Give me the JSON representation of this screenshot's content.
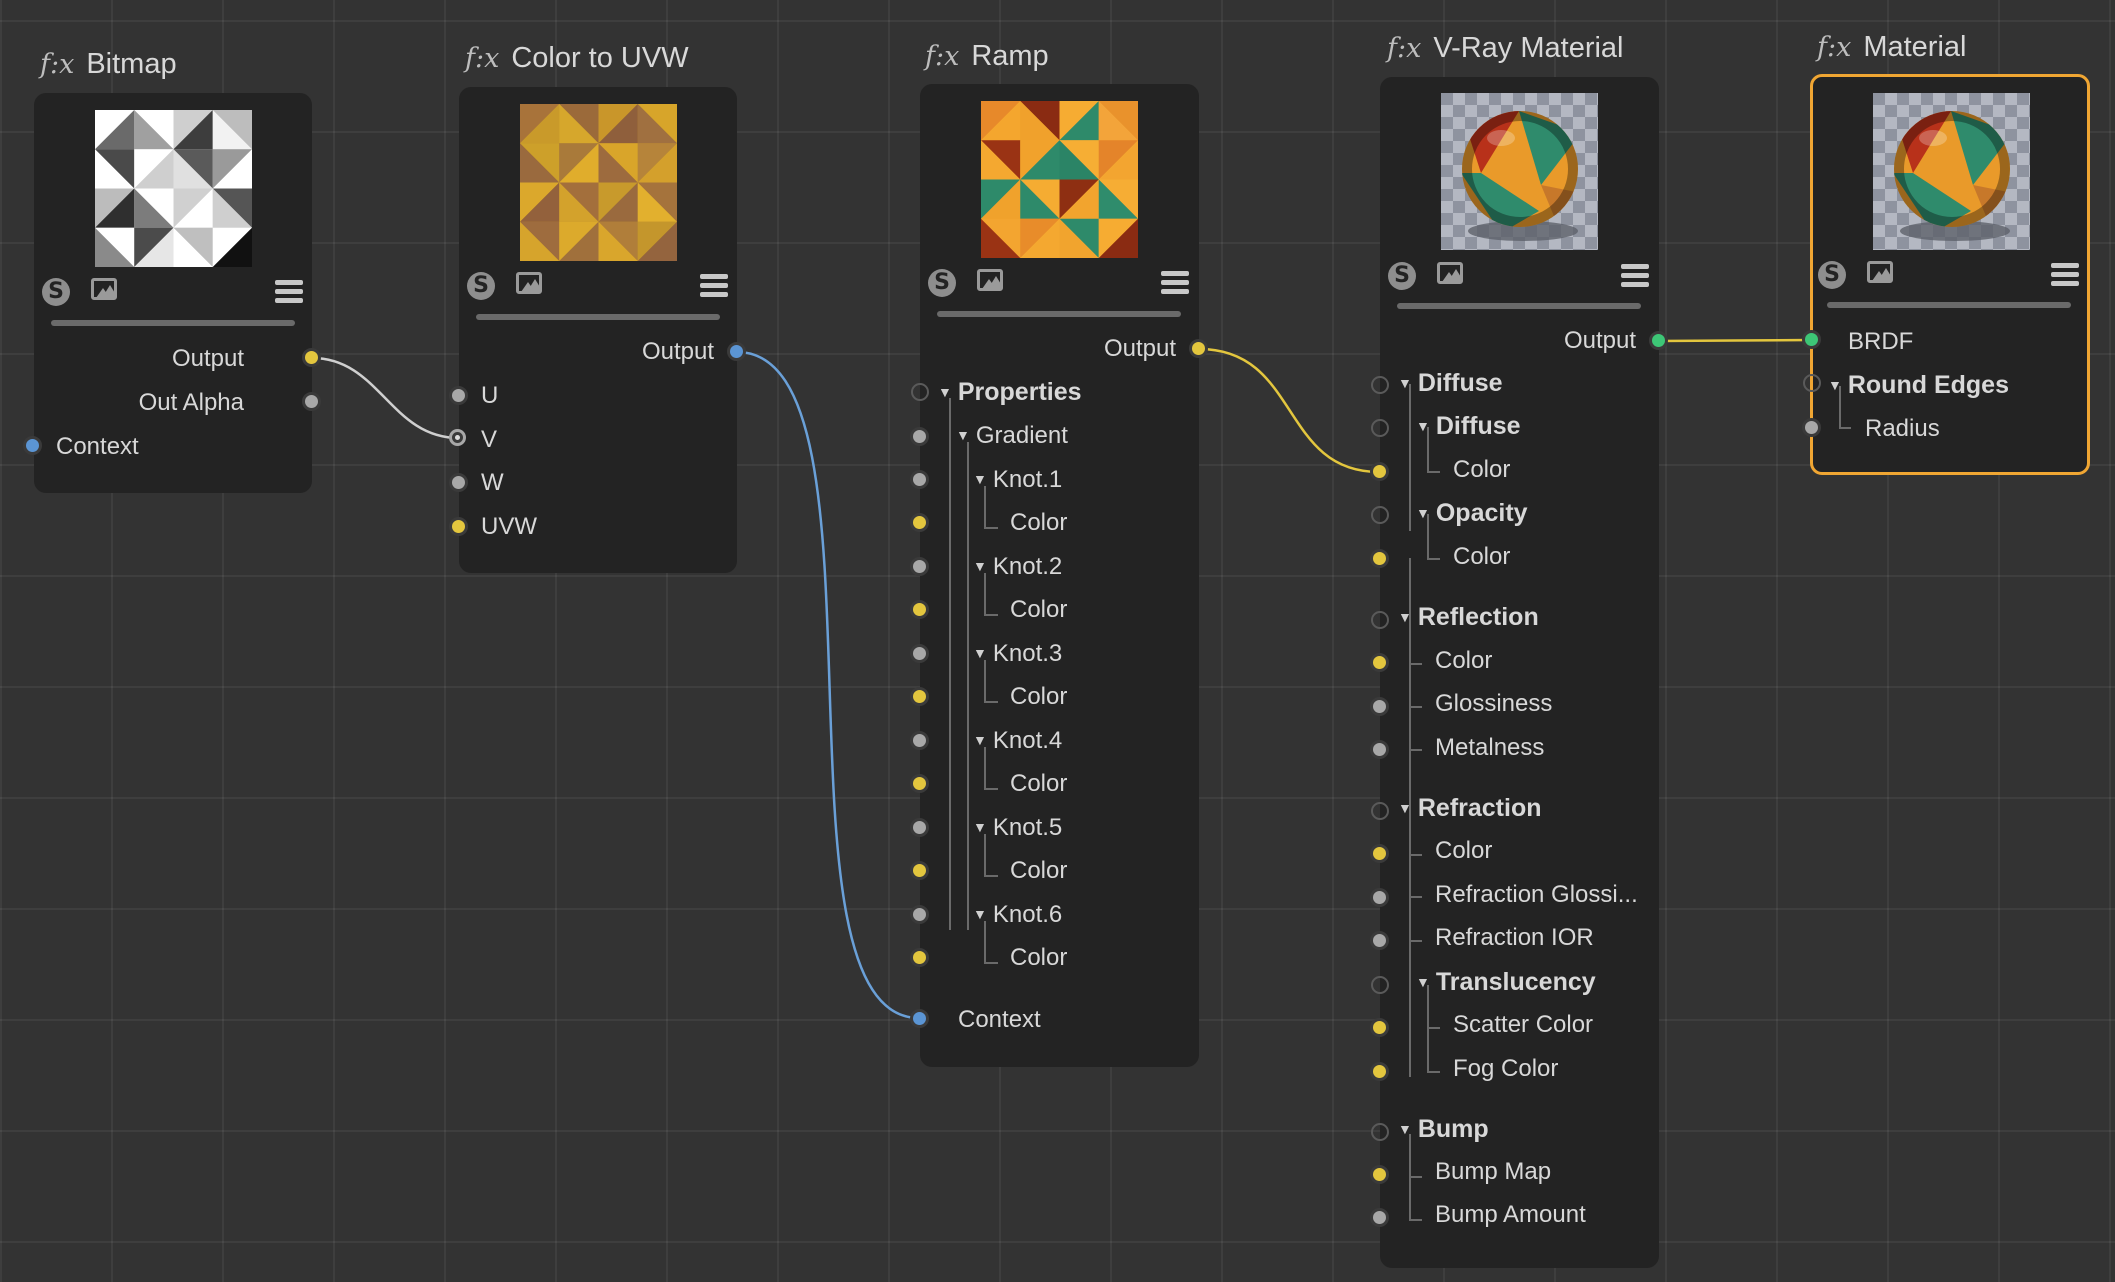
{
  "colors": {
    "background": "#333333",
    "node": "#232323",
    "selected_border": "#f0a633",
    "port_grey": "#a8a8a8",
    "port_yellow": "#e3c63e",
    "port_blue": "#5b95d4",
    "port_green": "#3dc676"
  },
  "fx_label": "f:x",
  "nodes": {
    "bitmap": {
      "title": "Bitmap",
      "outputs": [
        "Output",
        "Out Alpha"
      ],
      "inputs": [
        "Context"
      ]
    },
    "color_to_uvw": {
      "title": "Color to UVW",
      "outputs": [
        "Output"
      ],
      "inputs": [
        "U",
        "V",
        "W",
        "UVW"
      ]
    },
    "ramp": {
      "title": "Ramp",
      "output": "Output",
      "properties": "Properties",
      "gradient": "Gradient",
      "knots": [
        "Knot.1",
        "Knot.2",
        "Knot.3",
        "Knot.4",
        "Knot.5",
        "Knot.6"
      ],
      "color": "Color",
      "context": "Context"
    },
    "vray_material": {
      "title": "V-Ray Material",
      "output": "Output",
      "diffuse_group": "Diffuse",
      "diffuse_sub": "Diffuse",
      "diffuse_color": "Color",
      "opacity": "Opacity",
      "opacity_color": "Color",
      "reflection": "Reflection",
      "reflection_items": [
        "Color",
        "Glossiness",
        "Metalness"
      ],
      "refraction": "Refraction",
      "refraction_items": [
        "Color",
        "Refraction Glossi...",
        "Refraction IOR"
      ],
      "translucency": "Translucency",
      "translucency_items": [
        "Scatter Color",
        "Fog Color"
      ],
      "bump": "Bump",
      "bump_items": [
        "Bump Map",
        "Bump Amount"
      ]
    },
    "material": {
      "title": "Material",
      "brdf": "BRDF",
      "round_edges": "Round Edges",
      "radius": "Radius"
    }
  },
  "icons": {
    "shader": "s-icon",
    "image": "image-icon",
    "menu": "hamburger-menu-icon",
    "expand": "triangle-down-icon"
  }
}
